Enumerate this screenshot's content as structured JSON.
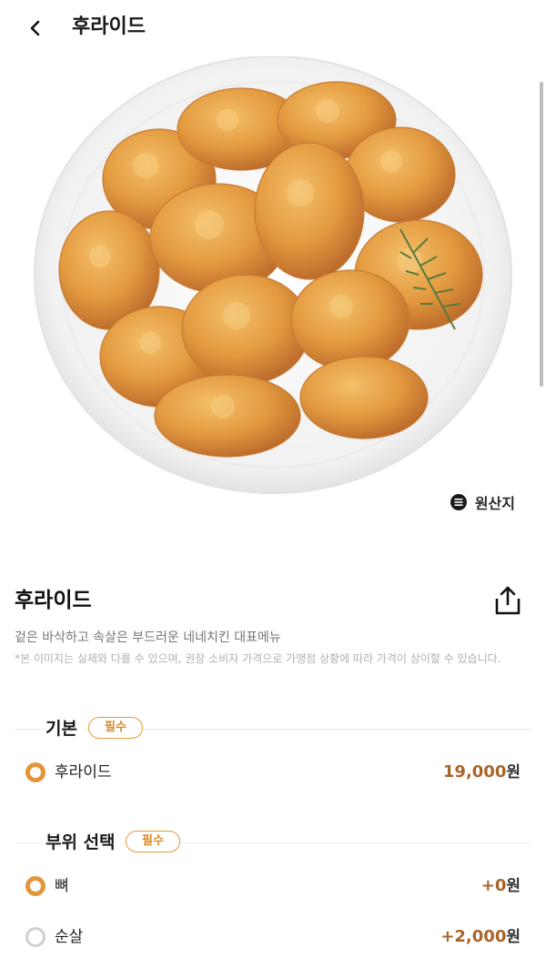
{
  "header": {
    "title": "후라이드",
    "back_icon": "chevron-left-icon"
  },
  "hero": {
    "image_alt": "fried chicken on white plate"
  },
  "origin_button": {
    "label": "원산지",
    "icon": "list-circle-icon"
  },
  "product": {
    "name": "후라이드",
    "description": "겉은 바삭하고 속살은 부드러운 네네치킨 대표메뉴",
    "note": "*본 이미지는 실제와 다를 수 있으며, 권장 소비자 가격으로 가맹점 상황에 따라 가격이 상이할 수 있습니다.",
    "share_icon": "share-icon"
  },
  "sections": [
    {
      "title": "기본",
      "badge": "필수",
      "options": [
        {
          "label": "후라이드",
          "price": "19,000",
          "unit": "원",
          "selected": true
        }
      ]
    },
    {
      "title": "부위 선택",
      "badge": "필수",
      "options": [
        {
          "label": "뼈",
          "price": "+0",
          "unit": "원",
          "selected": true
        },
        {
          "label": "순살",
          "price": "+2,000",
          "unit": "원",
          "selected": false
        }
      ]
    }
  ],
  "colors": {
    "accent": "#e3953a",
    "price": "#a8652a",
    "badge_text": "#d98a24"
  }
}
